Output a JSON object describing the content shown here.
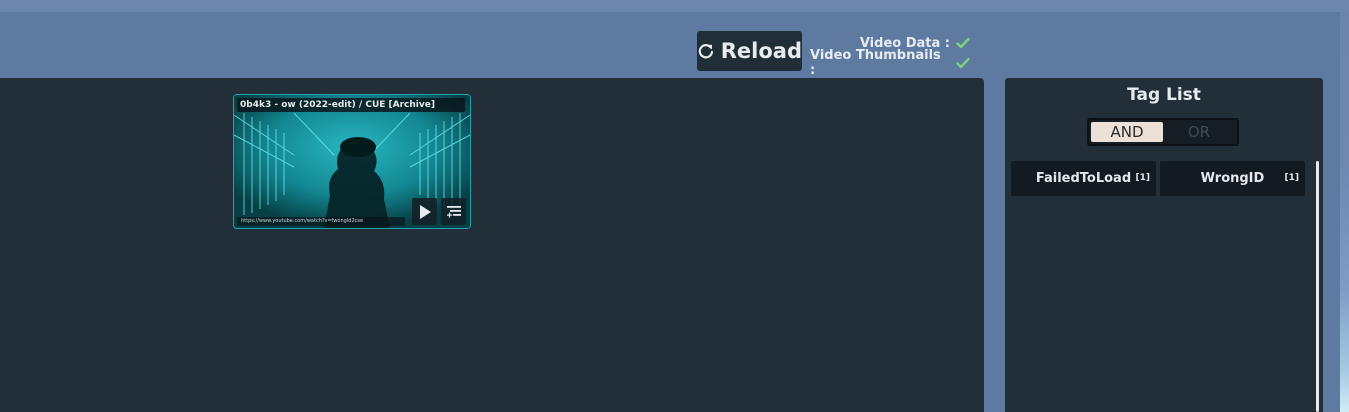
{
  "header": {
    "reload_label": "Reload",
    "status": [
      {
        "label": "Video Data :",
        "state": "ok"
      },
      {
        "label": "Video Thumbnails :",
        "state": "ok"
      }
    ]
  },
  "videos": [
    {
      "title": "0b4k3 - ow (2022-edit) / CUE [Archive]",
      "url": "https://www.youtube.com/watch?v=fwongId2cse"
    }
  ],
  "tag_list": {
    "title": "Tag List",
    "modes": [
      "AND",
      "OR"
    ],
    "selected_mode": "AND",
    "tags": [
      {
        "name": "FailedToLoad",
        "count": "[1]"
      },
      {
        "name": "WrongID",
        "count": "[1]"
      }
    ]
  },
  "colors": {
    "panel_bg": "#222f38",
    "header_bg": "#5f7aa0",
    "check_green": "#7ed07e",
    "card_accent": "#21a3ad"
  }
}
